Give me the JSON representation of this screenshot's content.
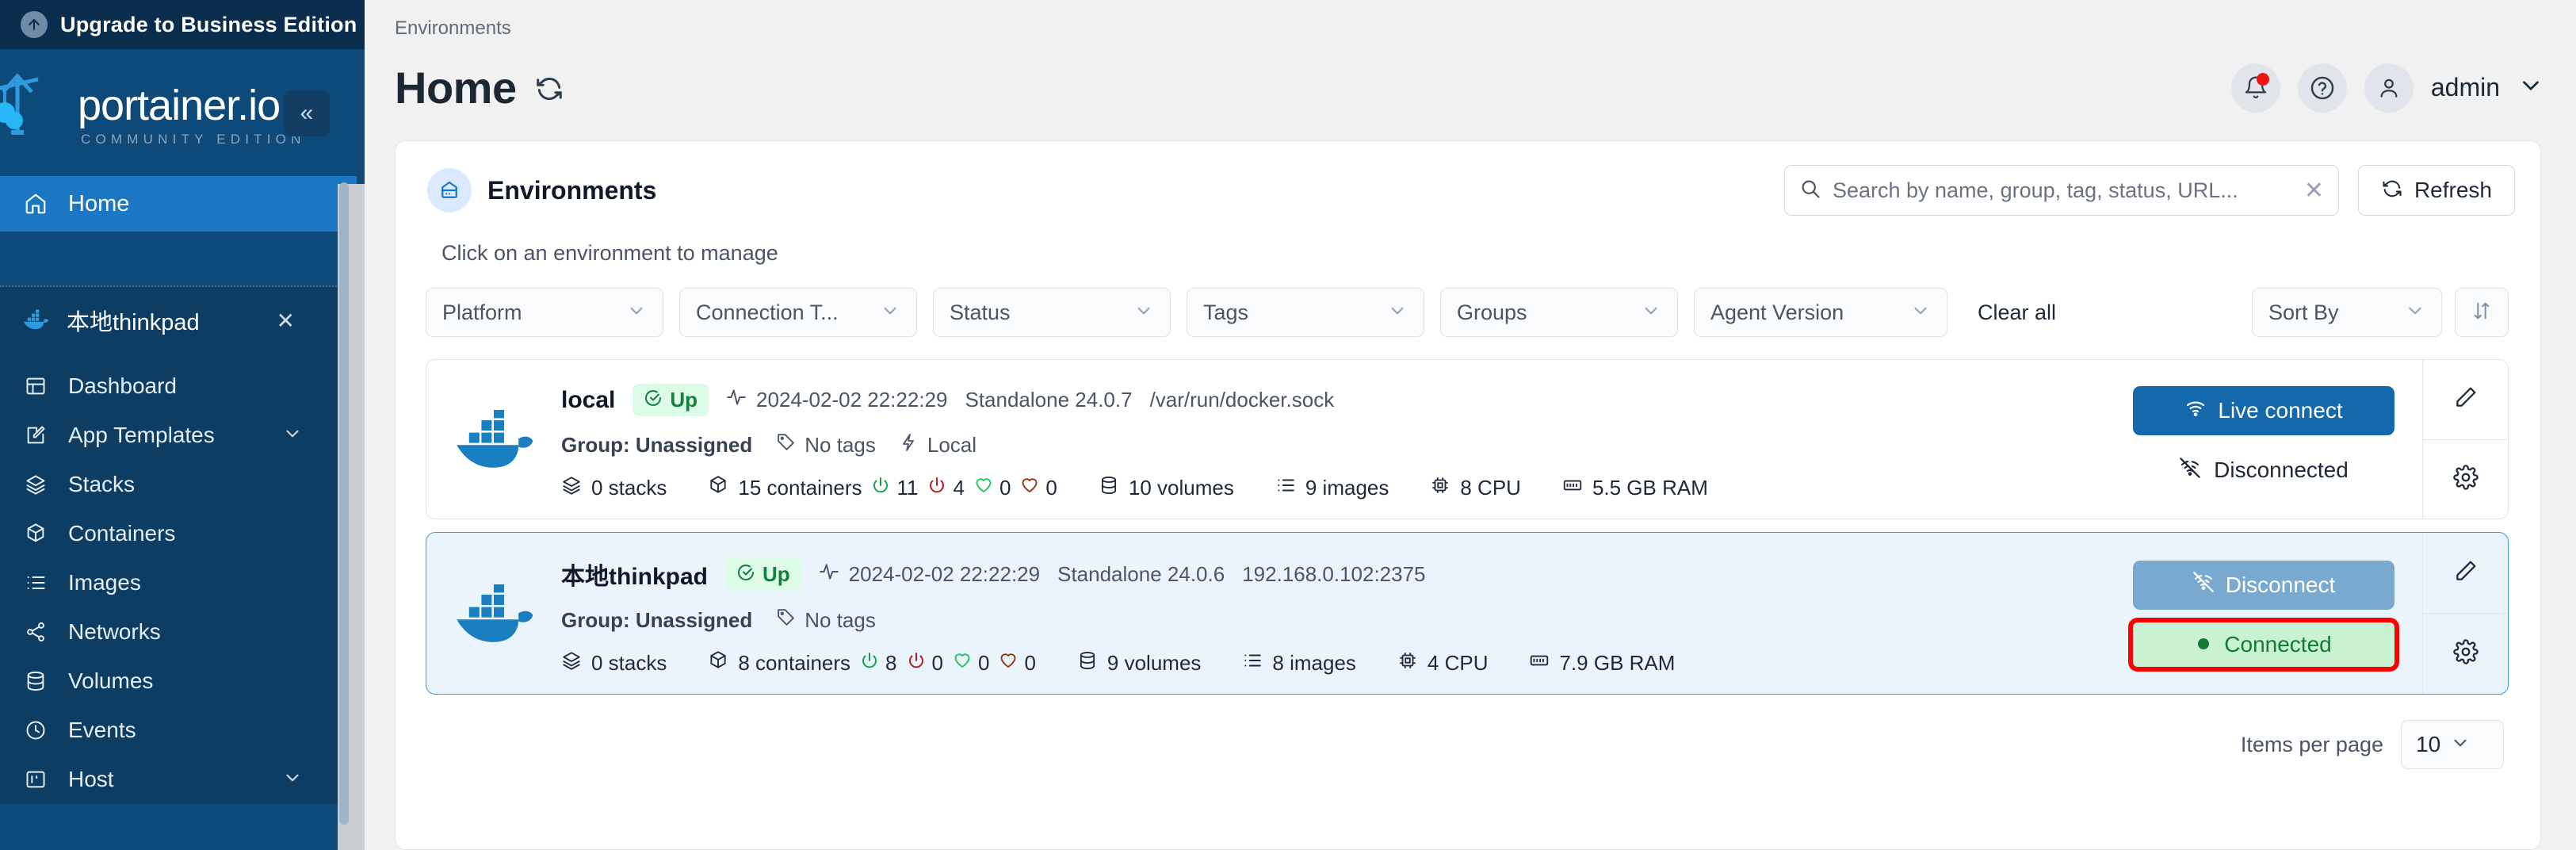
{
  "sidebar": {
    "upgrade_label": "Upgrade to Business Edition",
    "logo_text": "portainer.io",
    "logo_subtitle": "COMMUNITY EDITION",
    "collapse_icon": "chevrons-left-icon",
    "home_label": "Home",
    "environment_label": "本地thinkpad",
    "items": [
      {
        "label": "Dashboard",
        "icon": "dashboard-icon",
        "expandable": false
      },
      {
        "label": "App Templates",
        "icon": "edit-square-icon",
        "expandable": true
      },
      {
        "label": "Stacks",
        "icon": "layers-icon",
        "expandable": false
      },
      {
        "label": "Containers",
        "icon": "cube-icon",
        "expandable": false
      },
      {
        "label": "Images",
        "icon": "list-icon",
        "expandable": false
      },
      {
        "label": "Networks",
        "icon": "share-icon",
        "expandable": false
      },
      {
        "label": "Volumes",
        "icon": "database-icon",
        "expandable": false
      },
      {
        "label": "Events",
        "icon": "clock-icon",
        "expandable": false
      },
      {
        "label": "Host",
        "icon": "server-icon",
        "expandable": true
      }
    ]
  },
  "header": {
    "breadcrumb": "Environments",
    "title": "Home",
    "refresh_icon": "refresh-icon",
    "notification_icon": "bell-icon",
    "help_icon": "help-circle-icon",
    "user_icon": "user-icon",
    "user_name": "admin",
    "user_chevron": "chevron-down-icon"
  },
  "card": {
    "title": "Environments",
    "title_icon": "environment-icon",
    "hint": "Click on an environment to manage",
    "search": {
      "placeholder": "Search by name, group, tag, status, URL...",
      "value": "",
      "icon": "search-icon",
      "clear_icon": "close-icon"
    },
    "refresh_label": "Refresh",
    "filters": [
      {
        "label": "Platform",
        "name": "platform"
      },
      {
        "label": "Connection T...",
        "name": "connection-type"
      },
      {
        "label": "Status",
        "name": "status"
      },
      {
        "label": "Tags",
        "name": "tags"
      },
      {
        "label": "Groups",
        "name": "groups"
      },
      {
        "label": "Agent Version",
        "name": "agent-version"
      }
    ],
    "clear_all_label": "Clear all",
    "sort_by_label": "Sort By",
    "sort_dir_icon": "sort-icon",
    "items_per_page_label": "Items per page",
    "items_per_page_value": "10"
  },
  "environments": [
    {
      "name": "local",
      "status": "Up",
      "heartbeat": "2024-02-02 22:22:29",
      "kind": "Standalone 24.0.7",
      "url": "/var/run/docker.sock",
      "group": "Group: Unassigned",
      "tags": "No tags",
      "local_label": "Local",
      "show_local": true,
      "stacks": "0 stacks",
      "containers": "15 containers",
      "running": "11",
      "stopped": "4",
      "healthy": "0",
      "unhealthy": "0",
      "volumes": "10 volumes",
      "images": "9 images",
      "cpu": "8 CPU",
      "ram": "5.5 GB RAM",
      "action_label": "Live connect",
      "action_icon": "wifi-icon",
      "action_style": "primary",
      "connection_label": "Disconnected",
      "connection_icon": "wifi-off-icon",
      "connection_style": "plain",
      "selected": false,
      "highlighted": false
    },
    {
      "name": "本地thinkpad",
      "status": "Up",
      "heartbeat": "2024-02-02 22:22:29",
      "kind": "Standalone 24.0.6",
      "url": "192.168.0.102:2375",
      "group": "Group: Unassigned",
      "tags": "No tags",
      "local_label": "",
      "show_local": false,
      "stacks": "0 stacks",
      "containers": "8 containers",
      "running": "8",
      "stopped": "0",
      "healthy": "0",
      "unhealthy": "0",
      "volumes": "9 volumes",
      "images": "8 images",
      "cpu": "4 CPU",
      "ram": "7.9 GB RAM",
      "action_label": "Disconnect",
      "action_icon": "wifi-off-icon",
      "action_style": "muted",
      "connection_label": "Connected",
      "connection_icon": "dot-icon",
      "connection_style": "connected",
      "selected": true,
      "highlighted": true
    }
  ],
  "row_tools": {
    "edit_icon": "pencil-icon",
    "settings_icon": "gear-icon"
  },
  "colors": {
    "sidebar": "#0d4a7a",
    "sidebar_dark": "#0a2d4d",
    "accent": "#1b77c4",
    "primary_button": "#1369ac",
    "connected_bg": "#c9f2d2",
    "connected_text": "#137a34",
    "highlight_outline": "#ff0000",
    "up_badge_bg": "#dcfce7",
    "up_badge_text": "#15803d",
    "selected_row_bg": "#eaf4fd"
  }
}
